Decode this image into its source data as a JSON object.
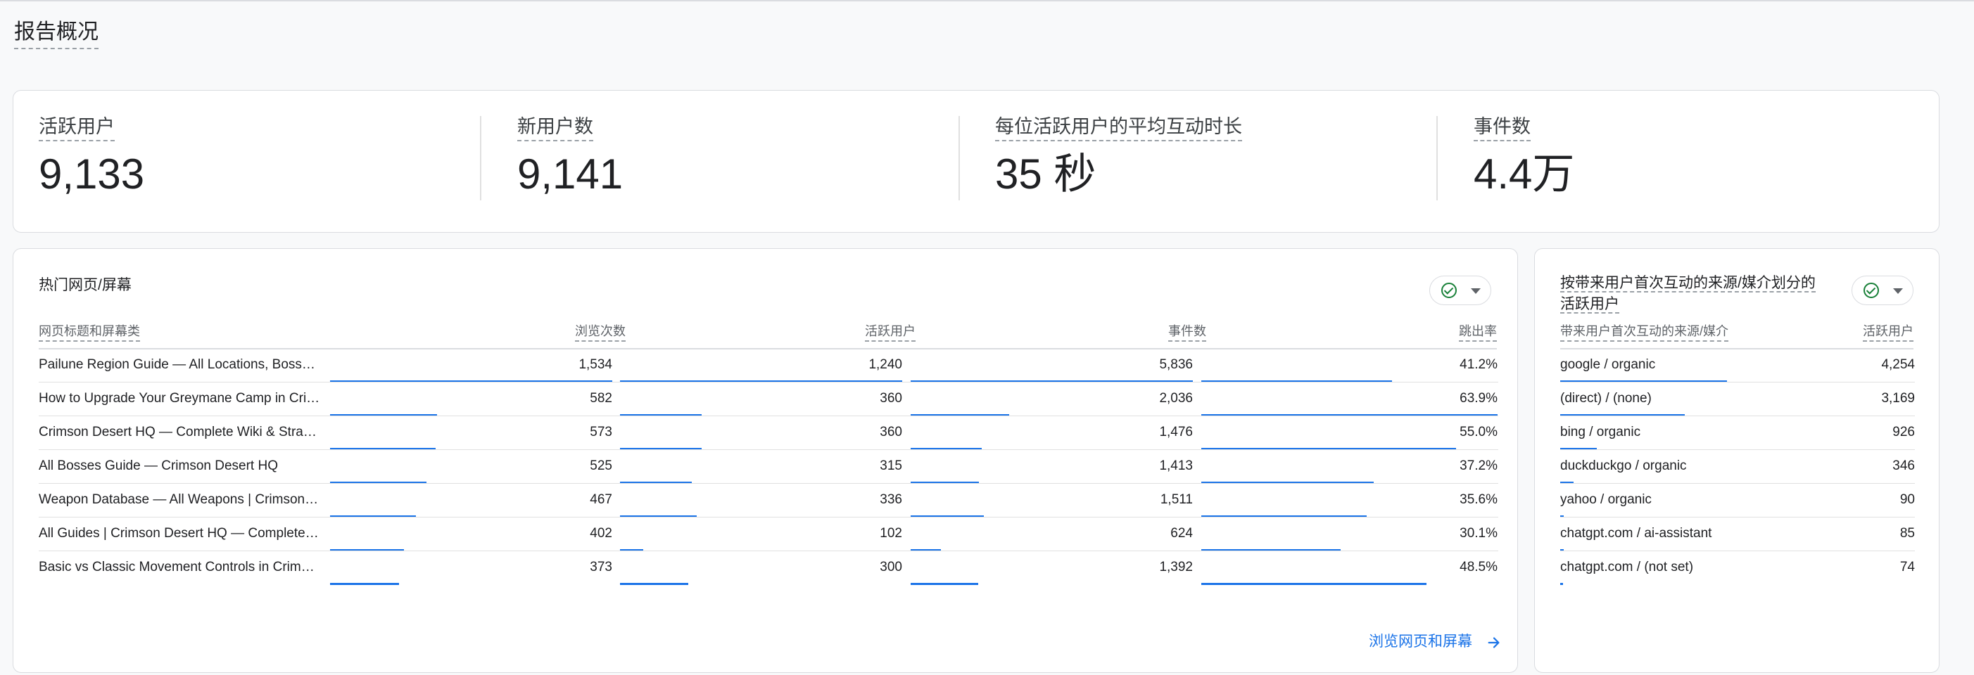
{
  "page": {
    "title": "报告概况"
  },
  "kpis": [
    {
      "label": "活跃用户",
      "value": "9,133"
    },
    {
      "label": "新用户数",
      "value": "9,141"
    },
    {
      "label": "每位活跃用户的平均互动时长",
      "value": "35 秒"
    },
    {
      "label": "事件数",
      "value": "4.4万"
    }
  ],
  "pages_table": {
    "title": "热门网页/屏幕",
    "columns": [
      "网页标题和屏幕类",
      "浏览次数",
      "活跃用户",
      "事件数",
      "跳出率"
    ],
    "rows": [
      {
        "name": "Pailune Region Guide — All Locations, Bosse…",
        "views": "1,534",
        "users": "1,240",
        "events": "5,836",
        "bounce": "41.2%",
        "views_n": 1534,
        "users_n": 1240,
        "events_n": 5836,
        "bounce_n": 41.2
      },
      {
        "name": "How to Upgrade Your Greymane Camp in Cri…",
        "views": "582",
        "users": "360",
        "events": "2,036",
        "bounce": "63.9%",
        "views_n": 582,
        "users_n": 360,
        "events_n": 2036,
        "bounce_n": 63.9
      },
      {
        "name": "Crimson Desert HQ — Complete Wiki & Strate…",
        "views": "573",
        "users": "360",
        "events": "1,476",
        "bounce": "55.0%",
        "views_n": 573,
        "users_n": 360,
        "events_n": 1476,
        "bounce_n": 55.0
      },
      {
        "name": "All Bosses Guide — Crimson Desert HQ",
        "views": "525",
        "users": "315",
        "events": "1,413",
        "bounce": "37.2%",
        "views_n": 525,
        "users_n": 315,
        "events_n": 1413,
        "bounce_n": 37.2
      },
      {
        "name": "Weapon Database — All Weapons | Crimson D…",
        "views": "467",
        "users": "336",
        "events": "1,511",
        "bounce": "35.6%",
        "views_n": 467,
        "users_n": 336,
        "events_n": 1511,
        "bounce_n": 35.6
      },
      {
        "name": "All Guides | Crimson Desert HQ — Complete …",
        "views": "402",
        "users": "102",
        "events": "624",
        "bounce": "30.1%",
        "views_n": 402,
        "users_n": 102,
        "events_n": 624,
        "bounce_n": 30.1
      },
      {
        "name": "Basic vs Classic Movement Controls in Crims…",
        "views": "373",
        "users": "300",
        "events": "1,392",
        "bounce": "48.5%",
        "views_n": 373,
        "users_n": 300,
        "events_n": 1392,
        "bounce_n": 48.5
      }
    ],
    "link_label": "浏览网页和屏幕"
  },
  "source_table": {
    "title": "按带来用户首次互动的来源/媒介划分的活跃用户",
    "title_line1": "按带来用户首次互动的来源/媒介划分的",
    "title_line2": "活跃用户",
    "columns": [
      "带来用户首次互动的来源/媒介",
      "活跃用户"
    ],
    "rows": [
      {
        "name": "google / organic",
        "users": "4,254",
        "users_n": 4254
      },
      {
        "name": "(direct) / (none)",
        "users": "3,169",
        "users_n": 3169
      },
      {
        "name": "bing / organic",
        "users": "926",
        "users_n": 926
      },
      {
        "name": "duckduckgo / organic",
        "users": "346",
        "users_n": 346
      },
      {
        "name": "yahoo / organic",
        "users": "90",
        "users_n": 90
      },
      {
        "name": "chatgpt.com / ai-assistant",
        "users": "85",
        "users_n": 85
      },
      {
        "name": "chatgpt.com / (not set)",
        "users": "74",
        "users_n": 74
      }
    ]
  },
  "colors": {
    "accent": "#1a73e8",
    "check": "#188038",
    "border": "#dadce0"
  },
  "icons": {
    "filter_check": "check-circle-icon",
    "dropdown": "chevron-down-icon",
    "link_arrow": "arrow-right-icon"
  }
}
